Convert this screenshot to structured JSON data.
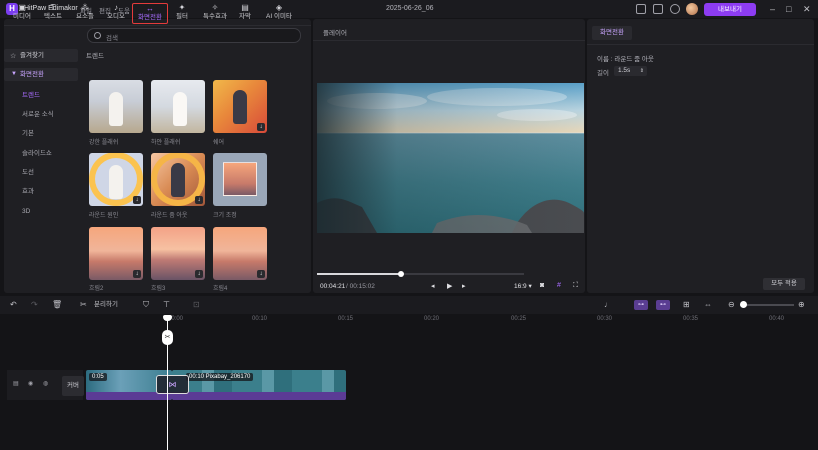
{
  "app": {
    "name": "HitPaw Edimakor",
    "menu": [
      "파일",
      "편집",
      "도움"
    ],
    "document_title": "2025-06-26_06",
    "export_label": "내보내기"
  },
  "toolbar": {
    "tabs": [
      {
        "label": "미디어",
        "icon": "media-icon"
      },
      {
        "label": "텍스트",
        "icon": "text-icon"
      },
      {
        "label": "요소들",
        "icon": "elements-icon"
      },
      {
        "label": "오디오",
        "icon": "audio-icon"
      },
      {
        "label": "화면전환",
        "icon": "transition-icon"
      },
      {
        "label": "필터",
        "icon": "filter-icon"
      },
      {
        "label": "특수효과",
        "icon": "effects-icon"
      },
      {
        "label": "자막",
        "icon": "subtitle-icon"
      },
      {
        "label": "AI 이미타",
        "icon": "ai-icon"
      }
    ],
    "active_tab": "화면전환",
    "accent_color": "#a86cff",
    "highlight_color": "#e43b3b"
  },
  "sidebar": {
    "favorites": "즐겨찾기",
    "category": "화면전환",
    "items": [
      "트렌드",
      "서로운 소식",
      "기본",
      "슬라이드쇼",
      "도선",
      "효과",
      "3D"
    ],
    "active_item": "트렌드"
  },
  "search": {
    "placeholder": "검색"
  },
  "gallery": {
    "section_title": "트렌드",
    "items": [
      {
        "label": "강한 플래쉬"
      },
      {
        "label": "하얀 플래쉬"
      },
      {
        "label": "쉐어"
      },
      {
        "label": "라운드 원인"
      },
      {
        "label": "라운드 줌 아웃"
      },
      {
        "label": "크기 조정"
      },
      {
        "label": "흐림2"
      },
      {
        "label": "흐림3"
      },
      {
        "label": "흐림4"
      }
    ]
  },
  "player": {
    "title": "플레이어",
    "current_time": "00:04:21",
    "total_time": "/ 00:15:02",
    "aspect": "16:9",
    "progress": 0.29
  },
  "properties": {
    "tab": "화면전환",
    "name_label": "이름 : 라운드 줌 아웃",
    "duration_label": "길이",
    "duration_value": "1.5s",
    "apply_all": "모두 적용"
  },
  "timeline": {
    "split_label": "분리하기",
    "ruler": [
      "00:00",
      "00:05",
      "00:10",
      "00:15",
      "00:20",
      "00:25",
      "00:30",
      "00:35",
      "00:40"
    ],
    "cover_label": "커버",
    "clips": [
      {
        "label": "0:05"
      },
      {
        "label": "00:10 Pixabay_206170"
      }
    ]
  }
}
